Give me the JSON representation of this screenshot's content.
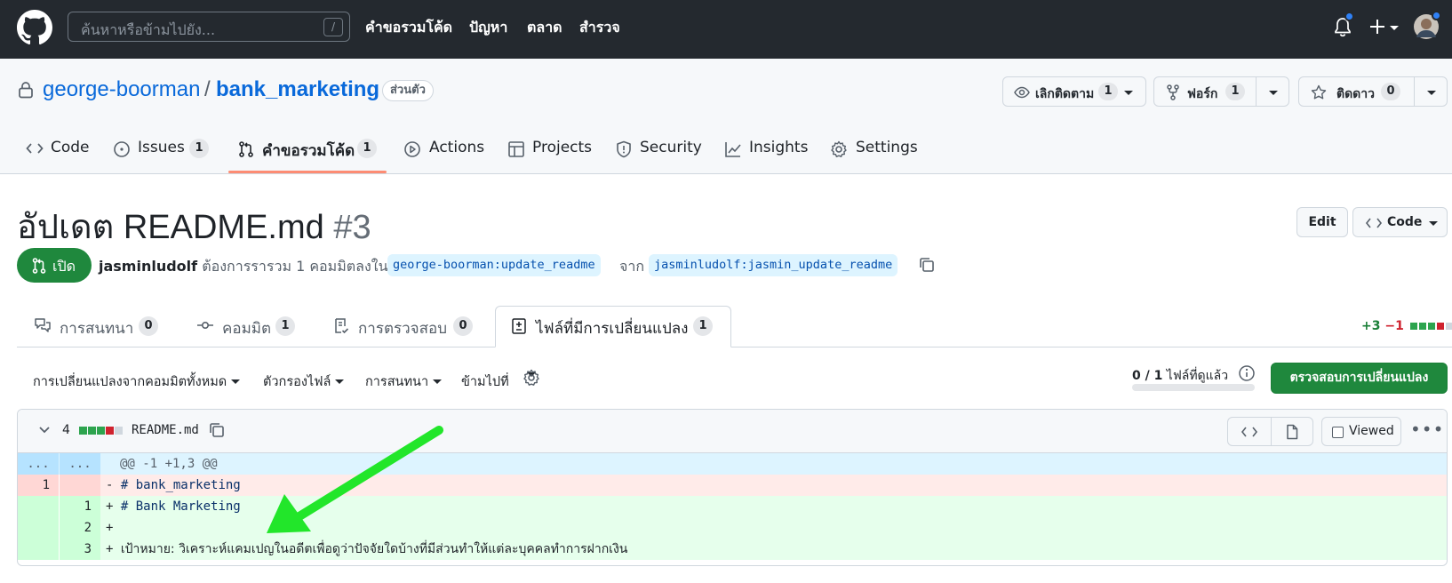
{
  "header": {
    "search_placeholder": "ค้นหาหรือข้ามไปยัง...",
    "search_shortcut": "/",
    "nav": [
      "คำขอรวมโค้ด",
      "ปัญหา",
      "ตลาด",
      "สำรวจ"
    ]
  },
  "repo": {
    "owner": "george-boorman",
    "separator": "/",
    "name": "bank_marketing",
    "visibility": "ส่วนตัว",
    "watch": {
      "label": "เลิกติดตาม",
      "count": "1"
    },
    "fork": {
      "label": "ฟอร์ก",
      "count": "1"
    },
    "star": {
      "label": "ติดดาว",
      "count": "0"
    },
    "tabs": [
      {
        "label": "Code",
        "count": ""
      },
      {
        "label": "Issues",
        "count": "1"
      },
      {
        "label": "คำขอรวมโค้ด",
        "count": "1"
      },
      {
        "label": "Actions",
        "count": ""
      },
      {
        "label": "Projects",
        "count": ""
      },
      {
        "label": "Security",
        "count": ""
      },
      {
        "label": "Insights",
        "count": ""
      },
      {
        "label": "Settings",
        "count": ""
      }
    ]
  },
  "pr": {
    "title": "อัปเดต README.md",
    "number": "#3",
    "edit_label": "Edit",
    "code_label": "Code",
    "state": "เปิด",
    "author": "jasminludolf",
    "meta_text": "ต้องการรารวม 1 คอมมิตลงใน",
    "base_branch": "george-boorman:update_readme",
    "from_text": "จาก",
    "head_branch": "jasminludolf:jasmin_update_readme",
    "tabs": [
      {
        "label": "การสนทนา",
        "count": "0"
      },
      {
        "label": "คอมมิต",
        "count": "1"
      },
      {
        "label": "การตรวจสอบ",
        "count": "0"
      },
      {
        "label": "ไฟล์ที่มีการเปลี่ยนแปลง",
        "count": "1"
      }
    ],
    "additions": "+3",
    "deletions": "−1"
  },
  "toolbar": {
    "changes_from": "การเปลี่ยนแปลงจากคอมมิตทั้งหมด",
    "file_filter": "ตัวกรองไฟล์",
    "conversations": "การสนทนา",
    "jump_to": "ข้ามไปที่",
    "viewed_count": "0 / 1",
    "viewed_suffix": "ไฟล์ที่ดูแล้ว",
    "viewed_progress": 0,
    "review_button": "ตรวจสอบการเปลี่ยนแปลง"
  },
  "file": {
    "changes": "4",
    "name": "README.md",
    "viewed_label": "Viewed",
    "hunk_header": "@@ -1 +1,3 @@",
    "hunk_dots": "...",
    "lines": [
      {
        "type": "del",
        "old": "1",
        "new": "",
        "prefix": "-",
        "text": "# bank_marketing"
      },
      {
        "type": "add",
        "old": "",
        "new": "1",
        "prefix": "+",
        "text": "# Bank Marketing"
      },
      {
        "type": "add",
        "old": "",
        "new": "2",
        "prefix": "+",
        "text": ""
      },
      {
        "type": "add",
        "old": "",
        "new": "3",
        "prefix": "+",
        "text": "เป้าหมาย: วิเคราะห์แคมเปญในอดีตเพื่อดูว่าปัจจัยใดบ้างที่มีส่วนทำให้แต่ละบุคคลทำการฝากเงิน"
      }
    ]
  },
  "colors": {
    "accent": "#0969da",
    "success": "#1f883d",
    "danger": "#cf222e",
    "annotation_arrow": "#22e62a"
  }
}
